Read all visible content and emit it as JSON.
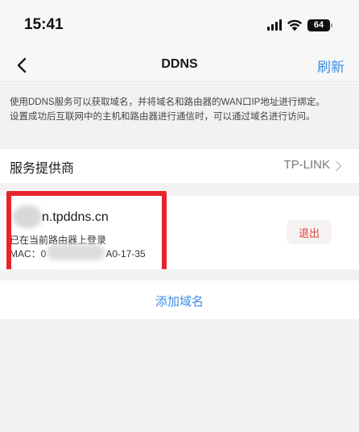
{
  "status_bar": {
    "time": "15:41",
    "battery": "64"
  },
  "nav": {
    "title": "DDNS",
    "refresh_label": "刷新"
  },
  "intro": {
    "text": "使用DDNS服务可以获取域名，并将域名和路由器的WAN口IP地址进行绑定。设置成功后互联网中的主机和路由器进行通信时，可以通过域名进行访问。"
  },
  "provider": {
    "label": "服务提供商",
    "value": "TP-LINK"
  },
  "domain": {
    "name": "n.tpddns.cn",
    "status": "已在当前路由器上登录",
    "mac_label": "MAC：0",
    "mac_suffix": "A0-17-35",
    "logout_label": "退出"
  },
  "actions": {
    "add_domain_label": "添加域名"
  },
  "colors": {
    "accent": "#3c8de6",
    "danger": "#e0463f",
    "highlight_frame": "#e8232d"
  }
}
